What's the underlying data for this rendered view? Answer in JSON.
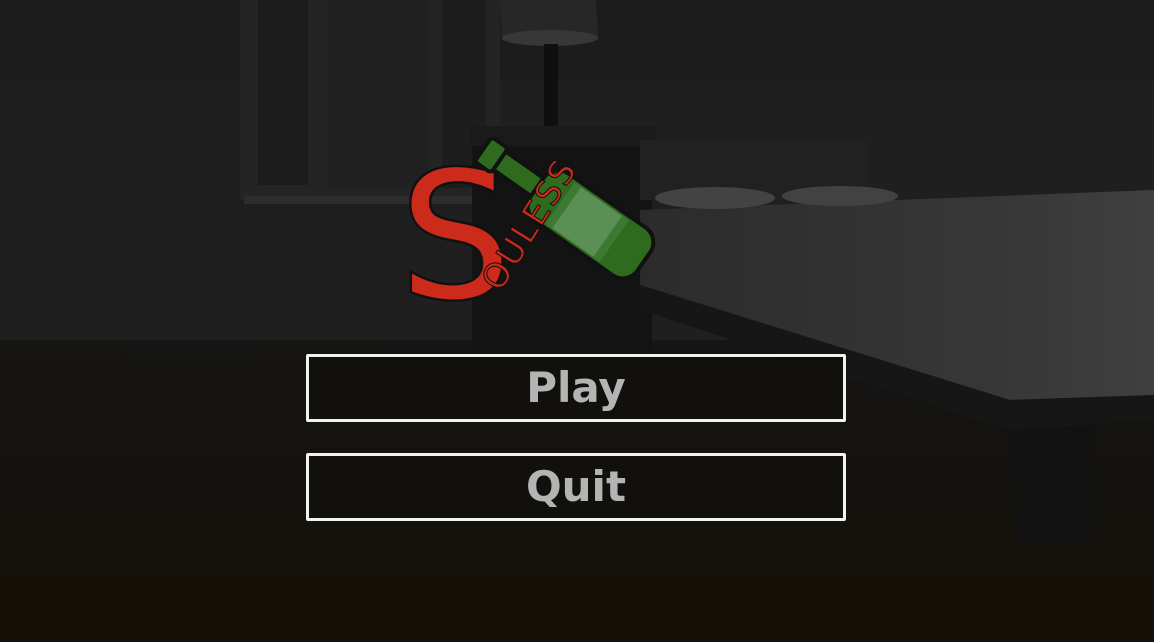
{
  "logo": {
    "initial": "S",
    "rest": "OULESS",
    "icon": "wine-bottle-icon",
    "colors": {
      "letters": "#cc2a1a",
      "bottle": "#2f6b1f",
      "bottle_label": "#4f8a4b",
      "outline": "#111111"
    }
  },
  "menu": {
    "play_label": "Play",
    "quit_label": "Quit",
    "colors": {
      "border": "#f2f2f2",
      "text": "#b4b4b4",
      "fill": "#12100d"
    }
  }
}
